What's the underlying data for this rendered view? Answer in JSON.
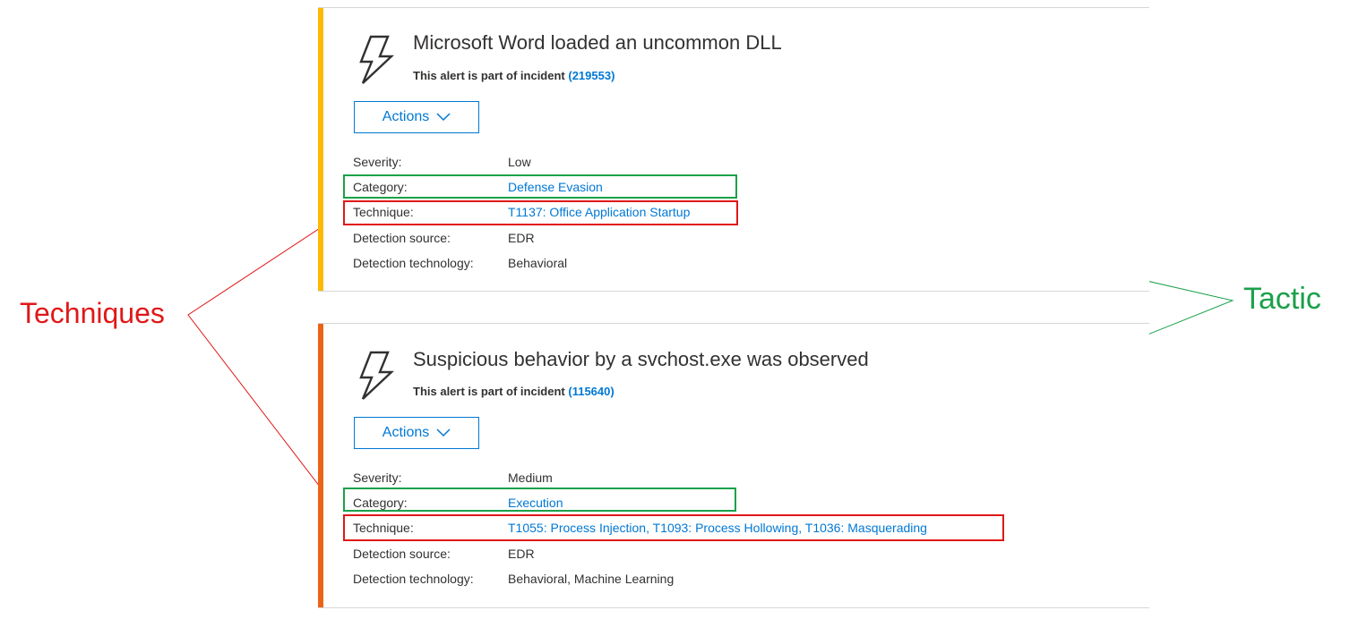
{
  "colors": {
    "accent_low": "#ffb900",
    "accent_medium": "#ea6417",
    "link": "#0078d4",
    "tactic": "#1aa14a",
    "technique": "#e01818"
  },
  "alerts": [
    {
      "icon": "lightning-icon",
      "title": "Microsoft Word loaded an uncommon DLL",
      "incident_prefix": "This alert is part of incident ",
      "incident_id": "(219553)",
      "actions_label": "Actions",
      "fields": {
        "severity_label": "Severity:",
        "severity": "Low",
        "category_label": "Category:",
        "category": "Defense Evasion",
        "technique_label": "Technique:",
        "technique": "T1137: Office Application Startup",
        "source_label": "Detection source:",
        "source": "EDR",
        "technology_label": "Detection technology:",
        "technology": "Behavioral"
      }
    },
    {
      "icon": "lightning-icon",
      "title": "Suspicious behavior by a svchost.exe was observed",
      "incident_prefix": "This alert is part of incident ",
      "incident_id": "(115640)",
      "actions_label": "Actions",
      "fields": {
        "severity_label": "Severity:",
        "severity": "Medium",
        "category_label": "Category:",
        "category": "Execution",
        "technique_label": "Technique:",
        "technique": "T1055: Process Injection, T1093: Process Hollowing, T1036: Masquerading",
        "source_label": "Detection source:",
        "source": "EDR",
        "technology_label": "Detection technology:",
        "technology": "Behavioral, Machine Learning"
      }
    }
  ],
  "annotations": {
    "techniques": "Techniques",
    "tactic": "Tactic"
  }
}
